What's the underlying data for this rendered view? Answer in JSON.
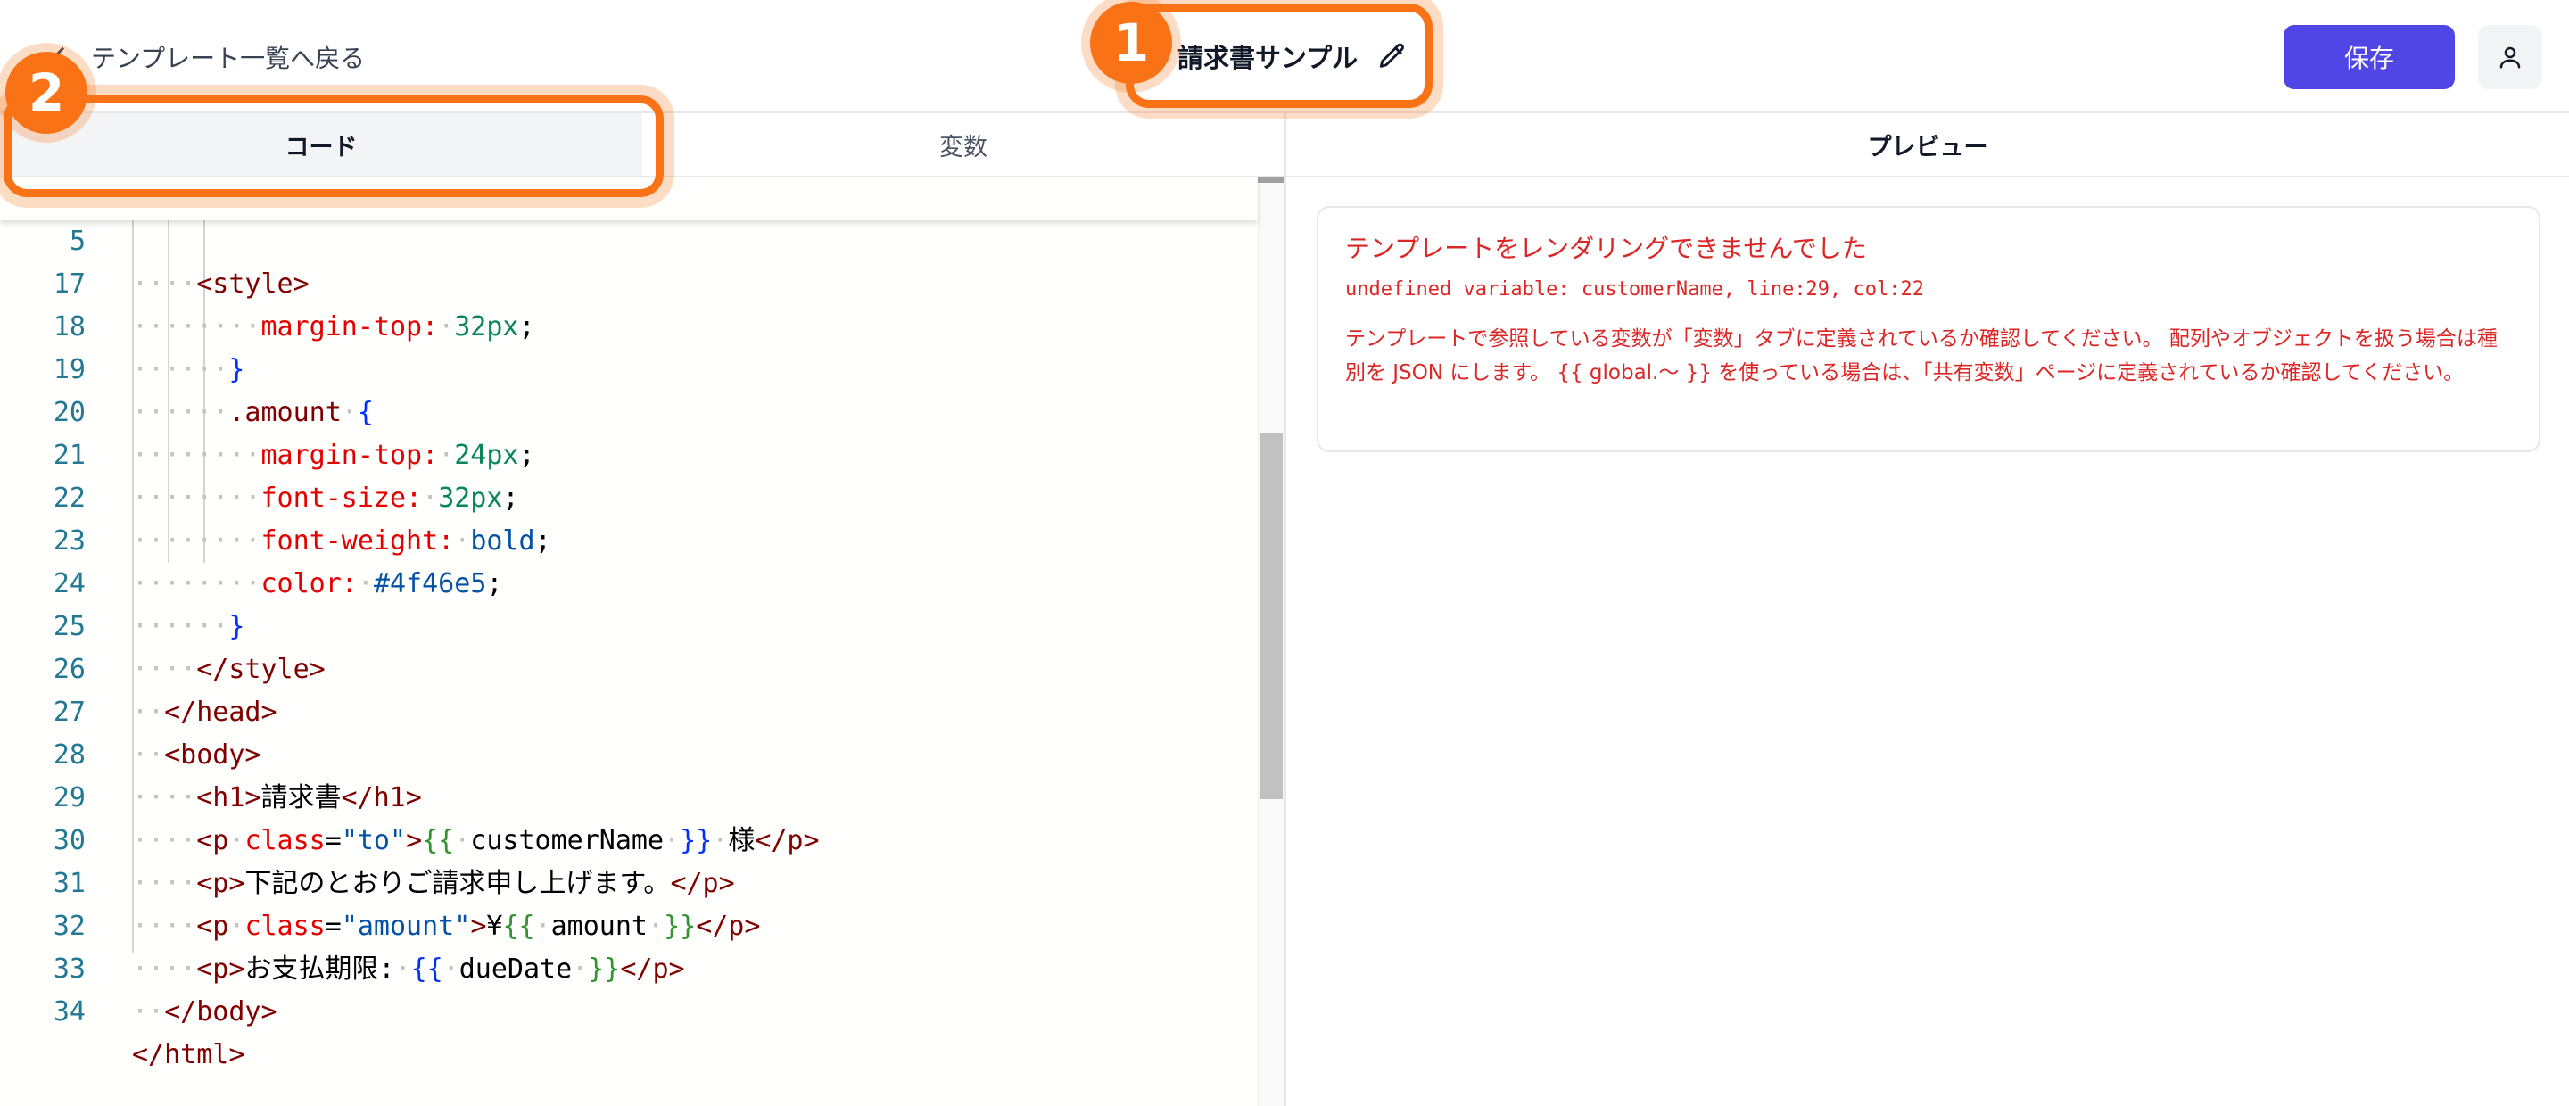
{
  "header": {
    "back_label": "テンプレート一覧へ戻る",
    "title": "請求書サンプル",
    "save_label": "保存",
    "icons": {
      "back": "chevron-left-icon",
      "edit": "pencil-icon",
      "user": "user-icon"
    }
  },
  "tabs": [
    {
      "label": "コード",
      "active": true
    },
    {
      "label": "変数",
      "active": false
    }
  ],
  "preview": {
    "heading": "プレビュー",
    "error_title": "テンプレートをレンダリングできませんでした",
    "error_detail": "undefined variable: customerName, line:29, col:22",
    "error_help": "テンプレートで参照している変数が「変数」タブに定義されているか確認してください。 配列やオブジェクトを扱う場合は種別を JSON にします。 {{ global.〜 }} を使っている場合は、「共有変数」ページに定義されているか確認してください。"
  },
  "editor": {
    "sticky": {
      "number": "5",
      "text": "    <style>"
    },
    "lines": [
      {
        "number": "17",
        "text": "        margin-top: 32px;"
      },
      {
        "number": "18",
        "text": "      }"
      },
      {
        "number": "19",
        "text": "      .amount {"
      },
      {
        "number": "20",
        "text": "        margin-top: 24px;"
      },
      {
        "number": "21",
        "text": "        font-size: 32px;"
      },
      {
        "number": "22",
        "text": "        font-weight: bold;"
      },
      {
        "number": "23",
        "text": "        color: #4f46e5;"
      },
      {
        "number": "24",
        "text": "      }"
      },
      {
        "number": "25",
        "text": "    </style>"
      },
      {
        "number": "26",
        "text": "  </head>"
      },
      {
        "number": "27",
        "text": "  <body>"
      },
      {
        "number": "28",
        "text": "    <h1>請求書</h1>"
      },
      {
        "number": "29",
        "text": "    <p class=\"to\">{{ customerName }} 様</p>"
      },
      {
        "number": "30",
        "text": "    <p>下記のとおりご請求申し上げます。</p>"
      },
      {
        "number": "31",
        "text": "    <p class=\"amount\">¥{{ amount }}</p>"
      },
      {
        "number": "32",
        "text": "    <p>お支払期限: {{ dueDate }}</p>"
      },
      {
        "number": "33",
        "text": "  </body>"
      },
      {
        "number": "34",
        "text": "</html>"
      }
    ]
  },
  "callouts": [
    {
      "number": "1",
      "target": "template-title"
    },
    {
      "number": "2",
      "target": "code-tab"
    }
  ],
  "colors": {
    "accent": "#4f46e5",
    "callout": "#f97316",
    "error": "#dc2626"
  }
}
